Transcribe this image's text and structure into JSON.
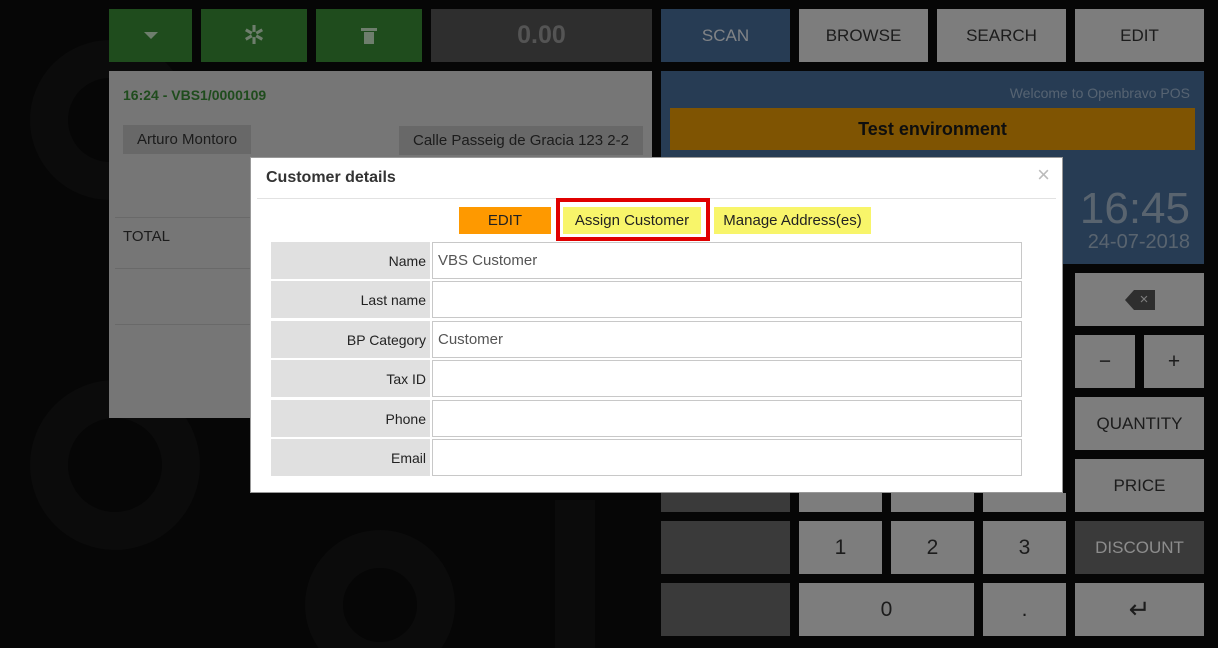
{
  "toolbar": {
    "dropdown_icon": "caret-down-icon",
    "asterisk_label": "✲",
    "trash_icon": "trash-icon",
    "amount": "0.00",
    "tabs": [
      "SCAN",
      "BROWSE",
      "SEARCH",
      "EDIT"
    ]
  },
  "ticket": {
    "reference": "16:24 - VBS1/0000109",
    "customer": "Arturo Montoro",
    "address": "Calle Passeig de Gracia 123 2-2",
    "total_label": "TOTAL"
  },
  "info": {
    "welcome": "Welcome to Openbravo POS",
    "environment": "Test environment",
    "time": "16:45",
    "date": "24-07-2018"
  },
  "keypad": {
    "minus": "−",
    "plus": "+",
    "quantity": "QUANTITY",
    "price": "PRICE",
    "discount": "DISCOUNT",
    "k1": "1",
    "k2": "2",
    "k3": "3",
    "k0": "0",
    "dot": ".",
    "enter": "↵",
    "backspace_icon": "backspace-icon"
  },
  "modal": {
    "title": "Customer details",
    "close": "×",
    "edit_label": "EDIT",
    "assign_label": "Assign Customer",
    "manage_label": "Manage Address(es)",
    "fields": [
      {
        "label": "Name",
        "value": "VBS Customer"
      },
      {
        "label": "Last name",
        "value": ""
      },
      {
        "label": "BP Category",
        "value": "Customer"
      },
      {
        "label": "Tax ID",
        "value": ""
      },
      {
        "label": "Phone",
        "value": ""
      },
      {
        "label": "Email",
        "value": ""
      }
    ]
  },
  "colors": {
    "green": "#3a8a36",
    "blue": "#486e99",
    "orange": "#fe9900",
    "yellow": "#f8f56a",
    "highlight": "#e00000"
  }
}
